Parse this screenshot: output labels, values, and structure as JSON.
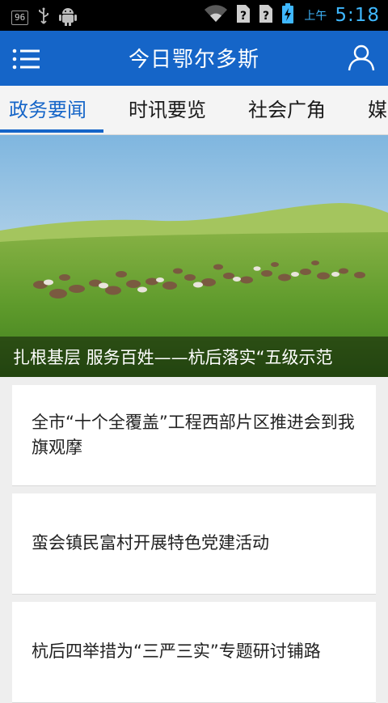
{
  "status_bar": {
    "badge": "96",
    "ampm": "上午",
    "time": "5:18",
    "icons": [
      "usb-icon",
      "android-debug-icon",
      "wifi-icon",
      "sim-unknown-icon",
      "sim-unknown-icon",
      "battery-charging-icon"
    ],
    "accent_color": "#3fb8ff"
  },
  "app_bar": {
    "title": "今日鄂尔多斯",
    "menu_icon": "menu-list-icon",
    "user_icon": "user-icon",
    "background": "#1565c8"
  },
  "tabs": [
    {
      "label": "政务要闻",
      "active": true
    },
    {
      "label": "时讯要览",
      "active": false
    },
    {
      "label": "社会广角",
      "active": false
    },
    {
      "label": "媒",
      "active": false
    }
  ],
  "hero": {
    "caption": "扎根基层 服务百姓——杭后落实“五级示范",
    "image": "grassland-with-grazing-sheep"
  },
  "news": [
    {
      "title": "全市“十个全覆盖”工程西部片区推进会到我旗观摩"
    },
    {
      "title": "蛮会镇民富村开展特色党建活动"
    },
    {
      "title": "杭后四举措为“三严三实”专题研讨铺路"
    }
  ]
}
